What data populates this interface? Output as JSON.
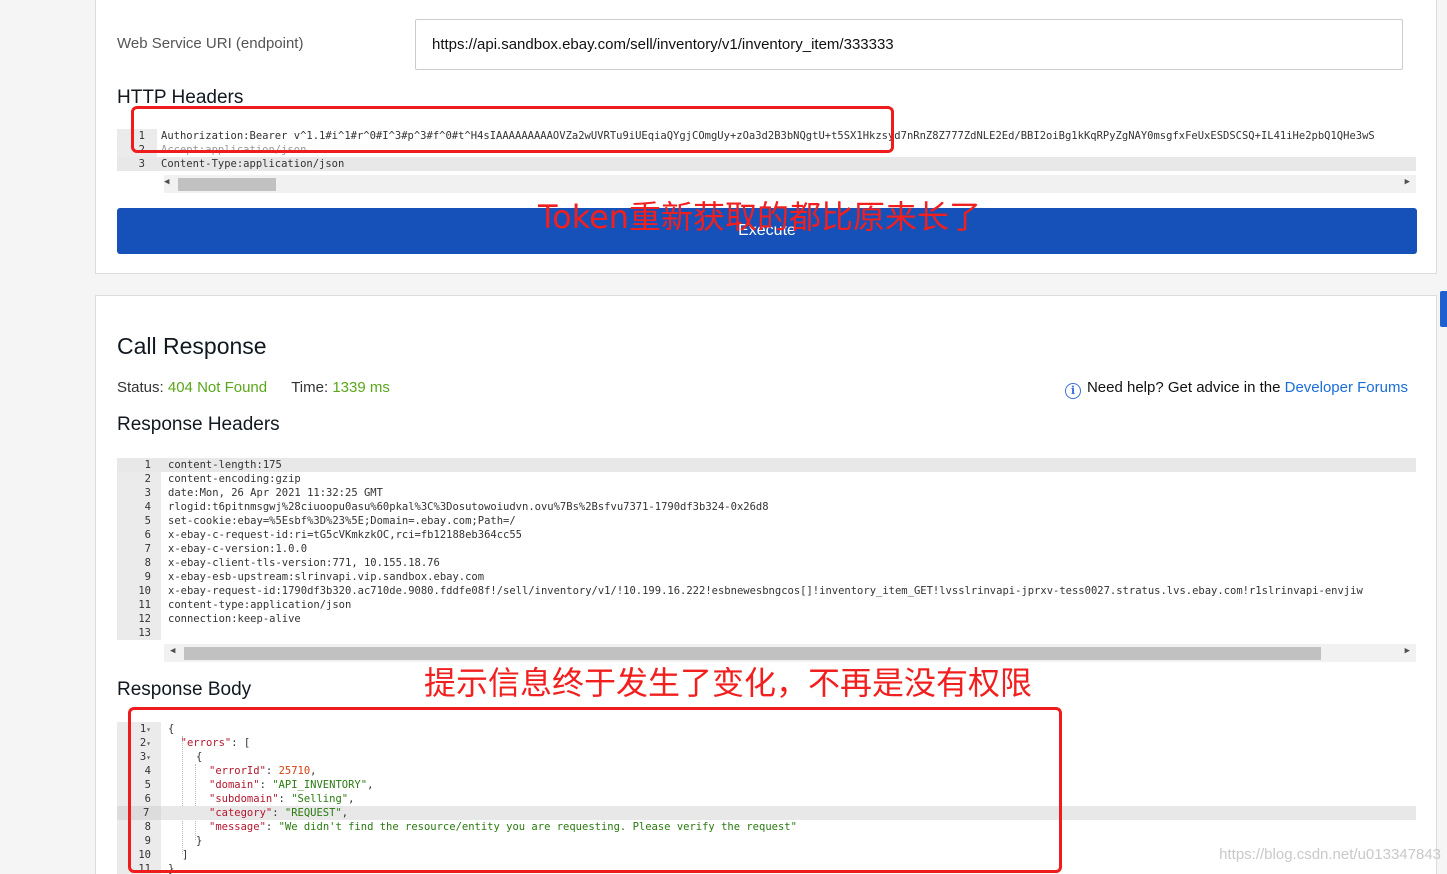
{
  "request": {
    "uri_label": "Web Service URI (endpoint)",
    "uri_value": "https://api.sandbox.ebay.com/sell/inventory/v1/inventory_item/333333",
    "headers_title": "HTTP Headers",
    "header_lines": [
      {
        "n": "1",
        "text": "Authorization:Bearer v^1.1#i^1#r^0#I^3#p^3#f^0#t^H4sIAAAAAAAAAOVZa2wUVRTu9iUEqiaQYgjCOmgUy+zOa3d2B3bNQgtU+t5SX1Hkzsyd7nRnZ8Z777ZdNLE2Ed/BBI2oiBg1kKqRPyZgNAY0msgfxFeUxESDSCSQ+IL41iHe2pbQ1QHe3wS"
      },
      {
        "n": "2",
        "text": "Accept:application/json"
      },
      {
        "n": "3",
        "text": "Content-Type:application/json"
      }
    ],
    "execute_label": "Execute"
  },
  "annotations": {
    "token_note": "Token重新获取的都比原来长了",
    "message_note": "提示信息终于发生了变化，不再是没有权限"
  },
  "response": {
    "title": "Call Response",
    "status_label": "Status:",
    "status_value": "404 Not Found",
    "time_label": "Time:",
    "time_value": "1339 ms",
    "help_text": "Need help? Get advice in the",
    "help_link": "Developer Forums",
    "headers_title": "Response Headers",
    "header_lines": [
      {
        "n": "1",
        "text": "content-length:175"
      },
      {
        "n": "2",
        "text": "content-encoding:gzip"
      },
      {
        "n": "3",
        "text": "date:Mon, 26 Apr 2021 11:32:25 GMT"
      },
      {
        "n": "4",
        "text": "rlogid:t6pitnmsgwj%28ciuoopu0asu%60pkal%3C%3Dosutowoiudvn.ovu%7Bs%2Bsfvu7371-1790df3b324-0x26d8"
      },
      {
        "n": "5",
        "text": "set-cookie:ebay=%5Esbf%3D%23%5E;Domain=.ebay.com;Path=/"
      },
      {
        "n": "6",
        "text": "x-ebay-c-request-id:ri=tG5cVKmkzkOC,rci=fb12188eb364cc55"
      },
      {
        "n": "7",
        "text": "x-ebay-c-version:1.0.0"
      },
      {
        "n": "8",
        "text": "x-ebay-client-tls-version:771, 10.155.18.76"
      },
      {
        "n": "9",
        "text": "x-ebay-esb-upstream:slrinvapi.vip.sandbox.ebay.com"
      },
      {
        "n": "10",
        "text": "x-ebay-request-id:1790df3b320.ac710de.9080.fddfe08f!/sell/inventory/v1/!10.199.16.222!esbnewesbngcos[]!inventory_item_GET!lvsslrinvapi-jprxv-tess0027.stratus.lvs.ebay.com!r1slrinvapi-envjiw"
      },
      {
        "n": "11",
        "text": "content-type:application/json"
      },
      {
        "n": "12",
        "text": "connection:keep-alive"
      },
      {
        "n": "13",
        "text": ""
      }
    ],
    "body_title": "Response Body",
    "body_lines": {
      "l1": "{",
      "l2_key": "\"errors\"",
      "l2_rest": ": [",
      "l3": "{",
      "l4_key": "\"errorId\"",
      "l4_val": "25710",
      "l5_key": "\"domain\"",
      "l5_val": "\"API_INVENTORY\"",
      "l6_key": "\"subdomain\"",
      "l6_val": "\"Selling\"",
      "l7_key": "\"category\"",
      "l7_val": "\"REQUEST\"",
      "l8_key": "\"message\"",
      "l8_val": "\"We didn't find the resource/entity you are requesting. Please verify the request\"",
      "l9": "}",
      "l10": "]",
      "l11": "}"
    }
  },
  "watermark": "https://blog.csdn.net/u013347843"
}
